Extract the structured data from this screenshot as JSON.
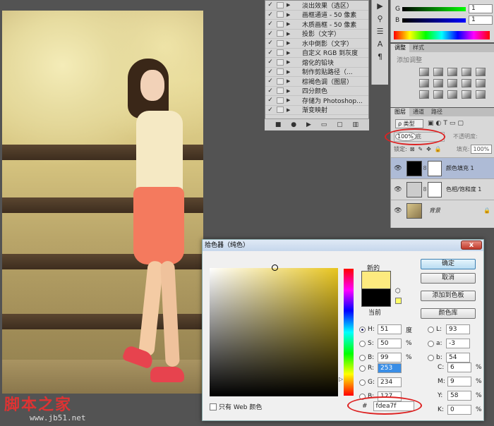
{
  "actions": {
    "items": [
      {
        "label": "淡出效果（选区）",
        "checked": true
      },
      {
        "label": "画框通道 - 50 像素",
        "checked": true
      },
      {
        "label": "木质画框 - 50 像素",
        "checked": true
      },
      {
        "label": "投影（文字）",
        "checked": true
      },
      {
        "label": "水中倒影（文字）",
        "checked": true
      },
      {
        "label": "自定义 RGB 到灰度",
        "checked": true
      },
      {
        "label": "熔化的铅块",
        "checked": true
      },
      {
        "label": "制作剪贴路径（...",
        "checked": true
      },
      {
        "label": "棕褐色调（图层）",
        "checked": true
      },
      {
        "label": "四分颜色",
        "checked": true
      },
      {
        "label": "存储为 Photoshop...",
        "checked": true
      },
      {
        "label": "渐变映射",
        "checked": true
      }
    ]
  },
  "color_panel": {
    "g_value": "1",
    "b_value": "1",
    "g_label": "G",
    "b_label": "B"
  },
  "adjustments": {
    "tabs": [
      "调整",
      "样式"
    ],
    "add_label": "添加调整"
  },
  "layers": {
    "tabs": [
      "图层",
      "通道",
      "路径"
    ],
    "kind": "ρ 类型",
    "blend_mode": "正片叠底",
    "opacity_label": "不透明度:",
    "opacity_value": "100%",
    "lock_label": "锁定:",
    "fill_label": "填充:",
    "fill_value": "100%",
    "items": [
      {
        "name": "颜色填充 1",
        "selected": true
      },
      {
        "name": "色相/饱和度 1",
        "selected": false
      },
      {
        "name": "背景",
        "selected": false
      }
    ]
  },
  "dialog": {
    "title": "拾色器（纯色）",
    "close": "x",
    "new_label": "新的",
    "current_label": "当前",
    "new_color": "#fdea7f",
    "current_color": "#000000",
    "buttons": {
      "ok": "确定",
      "cancel": "取消",
      "add_swatch": "添加到色板",
      "library": "颜色库"
    },
    "hsb": [
      {
        "key": "H:",
        "value": "51",
        "unit": "度",
        "selected": true
      },
      {
        "key": "S:",
        "value": "50",
        "unit": "%",
        "selected": false
      },
      {
        "key": "B:",
        "value": "99",
        "unit": "%",
        "selected": false
      }
    ],
    "rgb": [
      {
        "key": "R:",
        "value": "253",
        "unit": "",
        "selected": false
      },
      {
        "key": "G:",
        "value": "234",
        "unit": "",
        "selected": false
      },
      {
        "key": "B:",
        "value": "127",
        "unit": "",
        "selected": false
      }
    ],
    "lab": [
      {
        "key": "L:",
        "value": "93"
      },
      {
        "key": "a:",
        "value": "-3"
      },
      {
        "key": "b:",
        "value": "54"
      }
    ],
    "cmyk": [
      {
        "key": "C:",
        "value": "6",
        "unit": "%"
      },
      {
        "key": "M:",
        "value": "9",
        "unit": "%"
      },
      {
        "key": "Y:",
        "value": "58",
        "unit": "%"
      },
      {
        "key": "K:",
        "value": "0",
        "unit": "%"
      }
    ],
    "web_only": "只有 Web 颜色",
    "hex_prefix": "#",
    "hex_value": "fdea7f"
  },
  "watermark": {
    "line1": "脚本之家",
    "line2": "www.jb51.net"
  }
}
